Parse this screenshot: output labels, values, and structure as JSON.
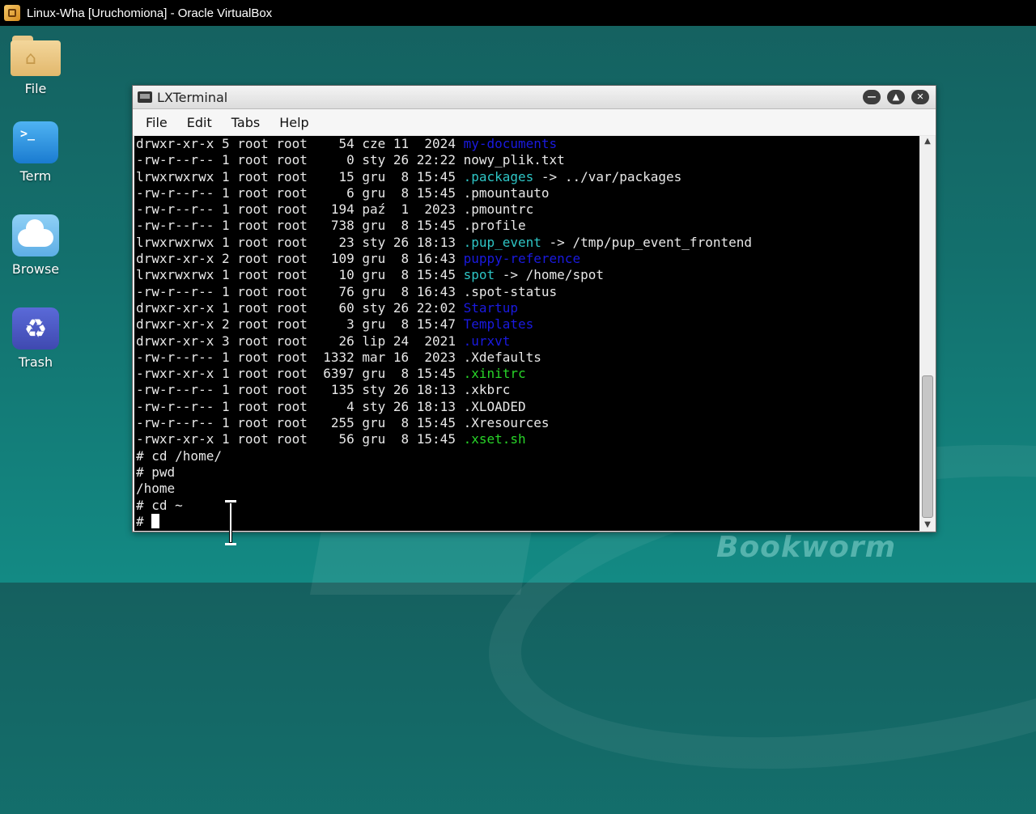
{
  "host_window": {
    "title": "Linux-Wha [Uruchomiona] - Oracle VirtualBox"
  },
  "desktop": {
    "icons": [
      {
        "label": "File",
        "icon": "home-folder-icon"
      },
      {
        "label": "Term",
        "icon": "terminal-icon"
      },
      {
        "label": "Browse",
        "icon": "cloud-icon"
      },
      {
        "label": "Trash",
        "icon": "recycle-icon"
      }
    ],
    "wallpaper_brand": "Bookworm"
  },
  "terminal": {
    "title": "LXTerminal",
    "menu": [
      "File",
      "Edit",
      "Tabs",
      "Help"
    ],
    "lines": [
      {
        "meta": "drwxr-xr-x 5 root root    54 cze 11  2024 ",
        "name": "my-documents",
        "color": "blue",
        "rest": ""
      },
      {
        "meta": "-rw-r--r-- 1 root root     0 sty 26 22:22 ",
        "name": "nowy_plik.txt",
        "color": "",
        "rest": ""
      },
      {
        "meta": "lrwxrwxrwx 1 root root    15 gru  8 15:45 ",
        "name": ".packages",
        "color": "cyan",
        "rest": " -> ../var/packages"
      },
      {
        "meta": "-rw-r--r-- 1 root root     6 gru  8 15:45 ",
        "name": ".pmountauto",
        "color": "",
        "rest": ""
      },
      {
        "meta": "-rw-r--r-- 1 root root   194 paź  1  2023 ",
        "name": ".pmountrc",
        "color": "",
        "rest": ""
      },
      {
        "meta": "-rw-r--r-- 1 root root   738 gru  8 15:45 ",
        "name": ".profile",
        "color": "",
        "rest": ""
      },
      {
        "meta": "lrwxrwxrwx 1 root root    23 sty 26 18:13 ",
        "name": ".pup_event",
        "color": "cyan",
        "rest": " -> /tmp/pup_event_frontend"
      },
      {
        "meta": "drwxr-xr-x 2 root root   109 gru  8 16:43 ",
        "name": "puppy-reference",
        "color": "blue",
        "rest": ""
      },
      {
        "meta": "lrwxrwxrwx 1 root root    10 gru  8 15:45 ",
        "name": "spot",
        "color": "cyan",
        "rest": " -> /home/spot"
      },
      {
        "meta": "-rw-r--r-- 1 root root    76 gru  8 16:43 ",
        "name": ".spot-status",
        "color": "",
        "rest": ""
      },
      {
        "meta": "drwxr-xr-x 1 root root    60 sty 26 22:02 ",
        "name": "Startup",
        "color": "blue",
        "rest": ""
      },
      {
        "meta": "drwxr-xr-x 2 root root     3 gru  8 15:47 ",
        "name": "Templates",
        "color": "blue",
        "rest": ""
      },
      {
        "meta": "drwxr-xr-x 3 root root    26 lip 24  2021 ",
        "name": ".urxvt",
        "color": "blue",
        "rest": ""
      },
      {
        "meta": "-rw-r--r-- 1 root root  1332 mar 16  2023 ",
        "name": ".Xdefaults",
        "color": "",
        "rest": ""
      },
      {
        "meta": "-rwxr-xr-x 1 root root  6397 gru  8 15:45 ",
        "name": ".xinitrc",
        "color": "green",
        "rest": ""
      },
      {
        "meta": "-rw-r--r-- 1 root root   135 sty 26 18:13 ",
        "name": ".xkbrc",
        "color": "",
        "rest": ""
      },
      {
        "meta": "-rw-r--r-- 1 root root     4 sty 26 18:13 ",
        "name": ".XLOADED",
        "color": "",
        "rest": ""
      },
      {
        "meta": "-rw-r--r-- 1 root root   255 gru  8 15:45 ",
        "name": ".Xresources",
        "color": "",
        "rest": ""
      },
      {
        "meta": "-rwxr-xr-x 1 root root    56 gru  8 15:45 ",
        "name": ".xset.sh",
        "color": "green",
        "rest": ""
      },
      {
        "meta": "# cd /home/",
        "name": "",
        "color": "",
        "rest": ""
      },
      {
        "meta": "# pwd",
        "name": "",
        "color": "",
        "rest": ""
      },
      {
        "meta": "/home",
        "name": "",
        "color": "",
        "rest": ""
      },
      {
        "meta": "# cd ~",
        "name": "",
        "color": "",
        "rest": ""
      }
    ],
    "prompt": "# "
  },
  "colors": {
    "desktop_teal": "#13706d",
    "terminal_bg": "#000000",
    "dir_blue": "#1a1ae0",
    "link_cyan": "#2ec5c5",
    "exec_green": "#28d428"
  }
}
